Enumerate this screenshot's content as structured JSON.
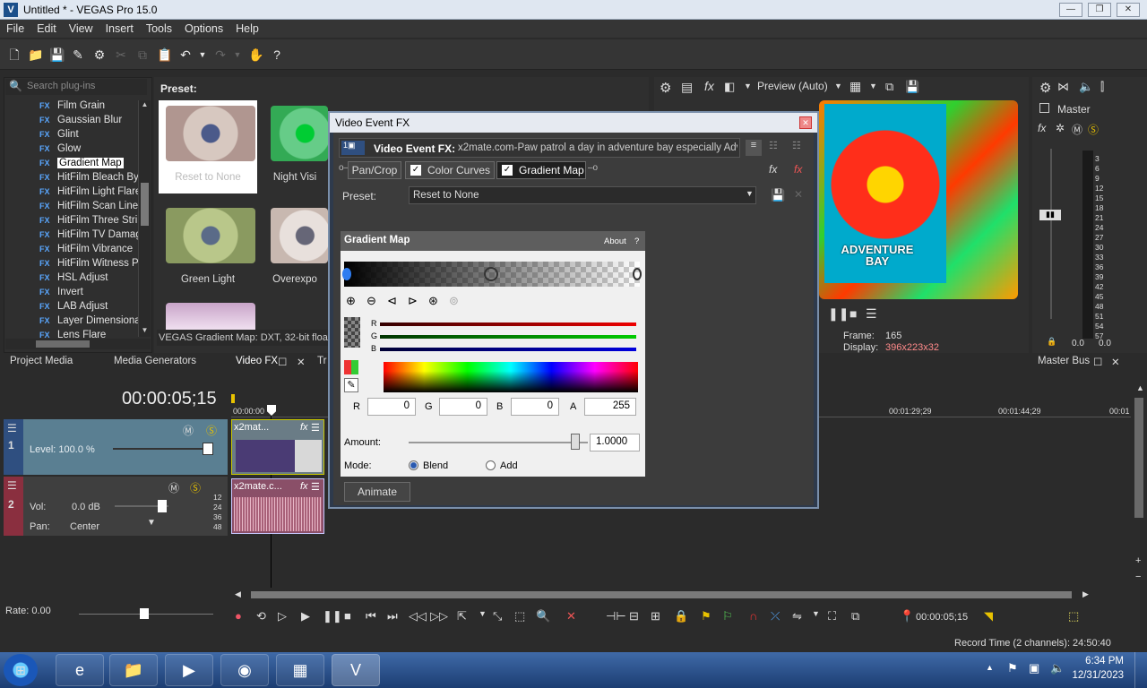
{
  "window": {
    "title": "Untitled * - VEGAS Pro 15.0",
    "icon_letter": "V"
  },
  "menu": [
    "File",
    "Edit",
    "View",
    "Insert",
    "Tools",
    "Options",
    "Help"
  ],
  "plugins": {
    "search_placeholder": "Search plug-ins",
    "items": [
      "Film Grain",
      "Gaussian Blur",
      "Glint",
      "Glow",
      "Gradient Map",
      "HitFilm Bleach Byp",
      "HitFilm Light Flares",
      "HitFilm Scan Lines",
      "HitFilm Three Strip",
      "HitFilm TV Damage",
      "HitFilm Vibrance",
      "HitFilm Witness Pr",
      "HSL Adjust",
      "Invert",
      "LAB Adjust",
      "Layer Dimensional",
      "Lens Flare"
    ],
    "selected": "Gradient Map",
    "fx_tag": "FX"
  },
  "presets": {
    "label": "Preset:",
    "thumbs": [
      "Reset to None",
      "Night Visi",
      "Green  Light",
      "Overexpo"
    ],
    "description": "VEGAS Gradient Map: DXT, 32-bit floati"
  },
  "tabs": {
    "project_media": "Project Media",
    "media_generators": "Media Generators",
    "video_fx": "Video FX",
    "tr": "Tr",
    "master_bus": "Master Bus"
  },
  "preview": {
    "mode": "Preview (Auto)",
    "frame_label": "Frame:",
    "frame_value": "165",
    "display_label": "Display:",
    "display_value": "396x223x32",
    "video_text": "ADVENTURE BAY"
  },
  "master": {
    "label": "Master",
    "scale": [
      "3",
      "6",
      "9",
      "12",
      "15",
      "18",
      "21",
      "24",
      "27",
      "30",
      "33",
      "36",
      "39",
      "42",
      "45",
      "48",
      "51",
      "54",
      "57"
    ],
    "readout_left": "0.0",
    "readout_right": "0.0"
  },
  "dialog": {
    "title": "Video Event FX",
    "fx_label": "Video Event FX:",
    "fx_name": "x2mate.com-Paw patrol a day in adventure bay especially Adv",
    "chain": [
      "Pan/Crop",
      "Color Curves",
      "Gradient Map"
    ],
    "preset_label": "Preset:",
    "preset_value": "Reset to None",
    "panel_title": "Gradient Map",
    "about": "About",
    "help": "?",
    "channels": [
      "R",
      "G",
      "B"
    ],
    "r_label": "R",
    "r_value": "0",
    "g_label": "G",
    "g_value": "0",
    "b_label": "B",
    "b_value": "0",
    "a_label": "A",
    "a_value": "255",
    "amount_label": "Amount:",
    "amount_value": "1.0000",
    "amount_fraction": 0.93,
    "mode_label": "Mode:",
    "mode_blend": "Blend",
    "mode_add": "Add",
    "mode_selected": "Blend",
    "animate": "Animate"
  },
  "timeline": {
    "timecode": "00:00:05;15",
    "ruler": [
      "00:00:00",
      "00:01:29;29",
      "00:01:44;29",
      "00:01"
    ],
    "track1": {
      "number": "1",
      "level": "Level: 100.0 %",
      "clip": "x2mat..."
    },
    "track2": {
      "number": "2",
      "vol_label": "Vol:",
      "vol_value": "0.0 dB",
      "pan_label": "Pan:",
      "pan_value": "Center",
      "clip": "x2mate.c...",
      "db_scale": [
        "12",
        "24",
        "36",
        "48"
      ]
    },
    "rate": "Rate: 0.00",
    "transport_time": "00:00:05;15"
  },
  "status": {
    "record_time": "Record Time (2 channels): 24:50:40"
  },
  "taskbar": {
    "time": "6:34 PM",
    "date": "12/31/2023"
  }
}
